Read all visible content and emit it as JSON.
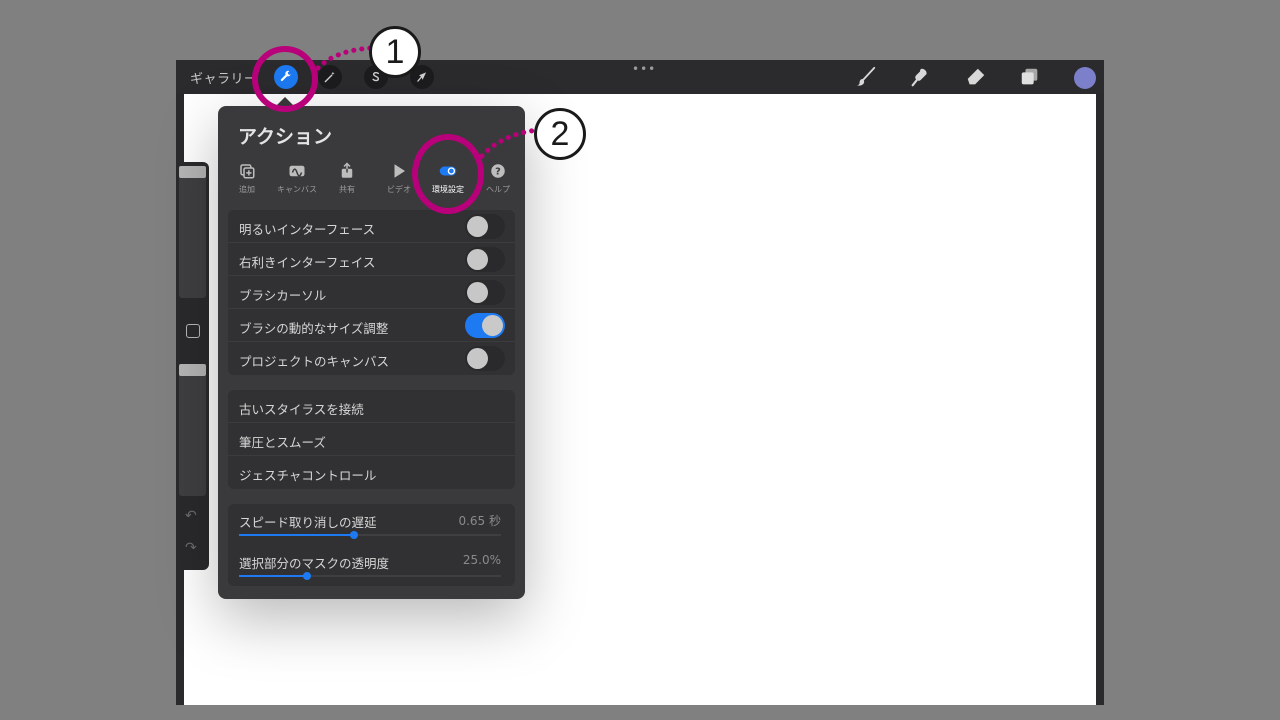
{
  "topbar": {
    "gallery_label": "ギャラリー",
    "more_glyph": "•••",
    "left_tools": [
      "wrench-icon",
      "magic-wand-icon",
      "selection-s-icon",
      "transform-arrow-icon"
    ],
    "right_tools": [
      "brush-icon",
      "smudge-icon",
      "eraser-icon",
      "layers-icon"
    ],
    "current_color": "#7c7fc9"
  },
  "sidebar": {
    "undo_glyph": "↶",
    "redo_glyph": "↷"
  },
  "panel": {
    "title": "アクション",
    "tabs": [
      {
        "label": "追加",
        "icon": "add-image-icon",
        "active": false
      },
      {
        "label": "キャンバス",
        "icon": "canvas-icon",
        "active": false
      },
      {
        "label": "共有",
        "icon": "share-icon",
        "active": false
      },
      {
        "label": "ビデオ",
        "icon": "play-icon",
        "active": false
      },
      {
        "label": "環境設定",
        "icon": "toggle-icon",
        "active": true
      },
      {
        "label": "ヘルプ",
        "icon": "help-icon",
        "active": false
      }
    ],
    "toggles": [
      {
        "label": "明るいインターフェース",
        "on": false
      },
      {
        "label": "右利きインターフェイス",
        "on": false
      },
      {
        "label": "ブラシカーソル",
        "on": false
      },
      {
        "label": "ブラシの動的なサイズ調整",
        "on": true
      },
      {
        "label": "プロジェクトのキャンバス",
        "on": false
      }
    ],
    "links": [
      {
        "label": "古いスタイラスを接続"
      },
      {
        "label": "筆圧とスムーズ"
      },
      {
        "label": "ジェスチャコントロール"
      }
    ],
    "sliders": [
      {
        "label": "スピード取り消しの遅延",
        "value": "0.65 秒",
        "fraction": 0.44
      },
      {
        "label": "選択部分のマスクの透明度",
        "value": "25.0%",
        "fraction": 0.26
      }
    ]
  },
  "annotations": {
    "callout_1": "1",
    "callout_2": "2",
    "accent_color": "#b8007a"
  },
  "colors": {
    "accent_blue": "#1d7af2",
    "panel_bg": "#3a3a3c"
  }
}
